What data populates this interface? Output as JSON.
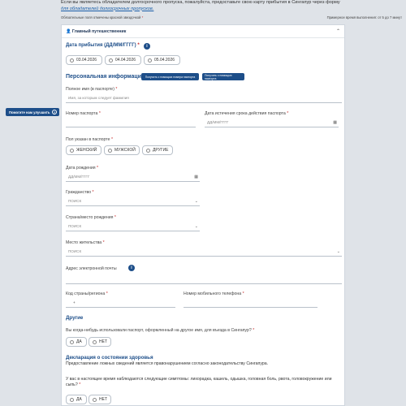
{
  "intro": {
    "text": "Если вы являетесь обладателем долгосрочного пропуска, пожалуйста, предоставьте свою карту прибытия в Сингапур через форму",
    "link": "для обладателей долгосрочных пропусков."
  },
  "meta": {
    "required_note": "Обязательные поля отмечены красной звездочкой",
    "required_mark": "*",
    "time_note": "Примерное время выполнения: от 5 до 7 минут"
  },
  "help_button": {
    "label": "Помогите нам улучшить",
    "icon": "question-icon"
  },
  "panel": {
    "title": "Главный путешественник",
    "icon": "user-icon",
    "chevron": "chevron-up-icon"
  },
  "arrival": {
    "label": "Дата прибытия (ДД/ММ/ГГГГ)",
    "options": [
      "03.04.2026",
      "04.04.2026",
      "05.04.2026"
    ]
  },
  "personal": {
    "title": "Персональная информация",
    "btn_auto": "Получить с помощью номера паспорта",
    "btn_manual": "Получить с помощью паспорта"
  },
  "fields": {
    "full_name": {
      "label": "Полное имя (в паспорте)",
      "placeholder": "Имя, за которым следует фамилия"
    },
    "passport_no": {
      "label": "Номер паспорта"
    },
    "passport_exp": {
      "label": "Дата истечения срока действия паспорта",
      "placeholder": "ДД/ММ/ГГГГ"
    },
    "sex": {
      "label": "Пол указан в паспорте",
      "options": [
        "ЖЕНСКИЙ",
        "МУЖСКОЙ",
        "ДРУГИЕ"
      ]
    },
    "dob": {
      "label": "Дата рождения",
      "placeholder": "ДД/ММ/ГГГГ"
    },
    "citizenship": {
      "label": "Гражданство",
      "placeholder": "ПОИСК"
    },
    "country_birth": {
      "label": "Страна/место рождения",
      "placeholder": "ПОИСК"
    },
    "residence": {
      "label": "Место жительства",
      "placeholder": "ПОИСК"
    },
    "email": {
      "label": "Адрес электронной почты"
    },
    "country_code": {
      "label": "Код страны/региона",
      "prefix": "+"
    },
    "mobile": {
      "label": "Номер мобильного телефона"
    }
  },
  "other": {
    "title": "Другие",
    "question": "Вы когда-нибудь использовали паспорт, оформленный на другое имя, для въезда в Сингапур?",
    "options": [
      "ДА",
      "НЕТ"
    ]
  },
  "health": {
    "title": "Декларация о состоянии здоровья",
    "warning": "Предоставление ложных сведений является правонарушением согласно законодательству Сингапура.",
    "question": "У вас в настоящее время наблюдаются следующие симптомы: лихорадка, кашель, одышка, головная боль, рвота, головокружение или сыпь?",
    "options": [
      "ДА",
      "НЕТ"
    ]
  }
}
